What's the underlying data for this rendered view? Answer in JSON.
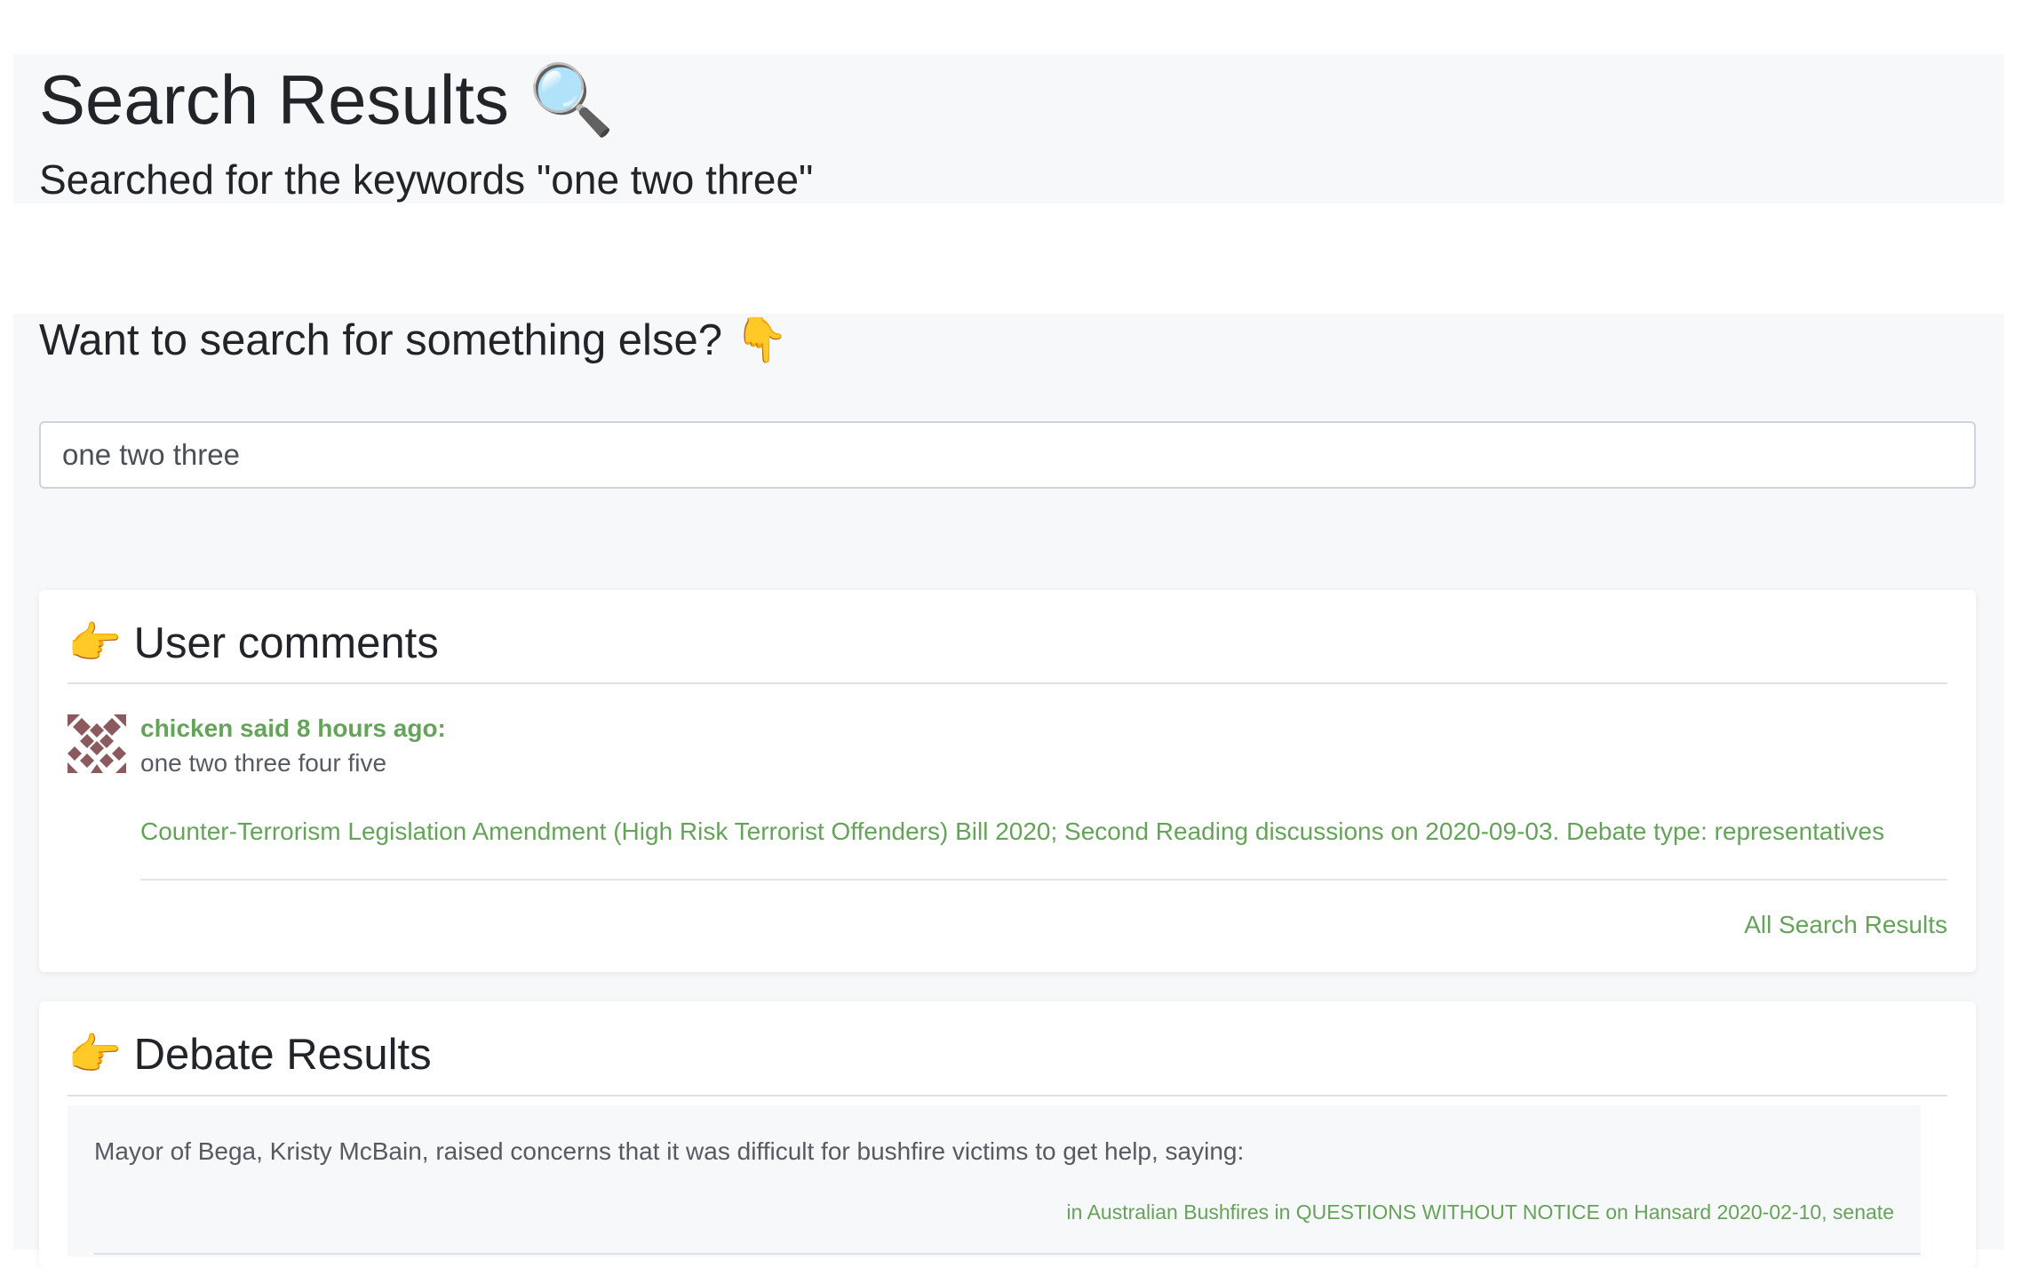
{
  "header": {
    "title": "Search Results",
    "title_icon": "🔍",
    "subtitle": "Searched for the keywords \"one two three\""
  },
  "search": {
    "heading": "Want to search for something else?",
    "heading_icon": "👇",
    "value": "one two three"
  },
  "comments": {
    "icon": "👉",
    "title": "User comments",
    "items": [
      {
        "author_line": "chicken said 8 hours ago:",
        "text": "one two three four five",
        "link": "Counter-Terrorism Legislation Amendment (High Risk Terrorist Offenders) Bill 2020; Second Reading discussions on 2020-09-03. Debate type: representatives"
      }
    ],
    "all_results_label": "All Search Results"
  },
  "debates": {
    "icon": "👉",
    "title": "Debate Results",
    "items": [
      {
        "quote": "Mayor of Bega, Kristy McBain, raised concerns that it was difficult for bushfire victims to get help, saying:",
        "source": "in Australian Bushfires in QUESTIONS WITHOUT NOTICE on Hansard 2020-02-10, senate"
      }
    ]
  },
  "colors": {
    "accent_green": "#66a35a",
    "panel_bg": "#f7f8f9",
    "text_dark": "#212529",
    "text_muted": "#555b61"
  }
}
